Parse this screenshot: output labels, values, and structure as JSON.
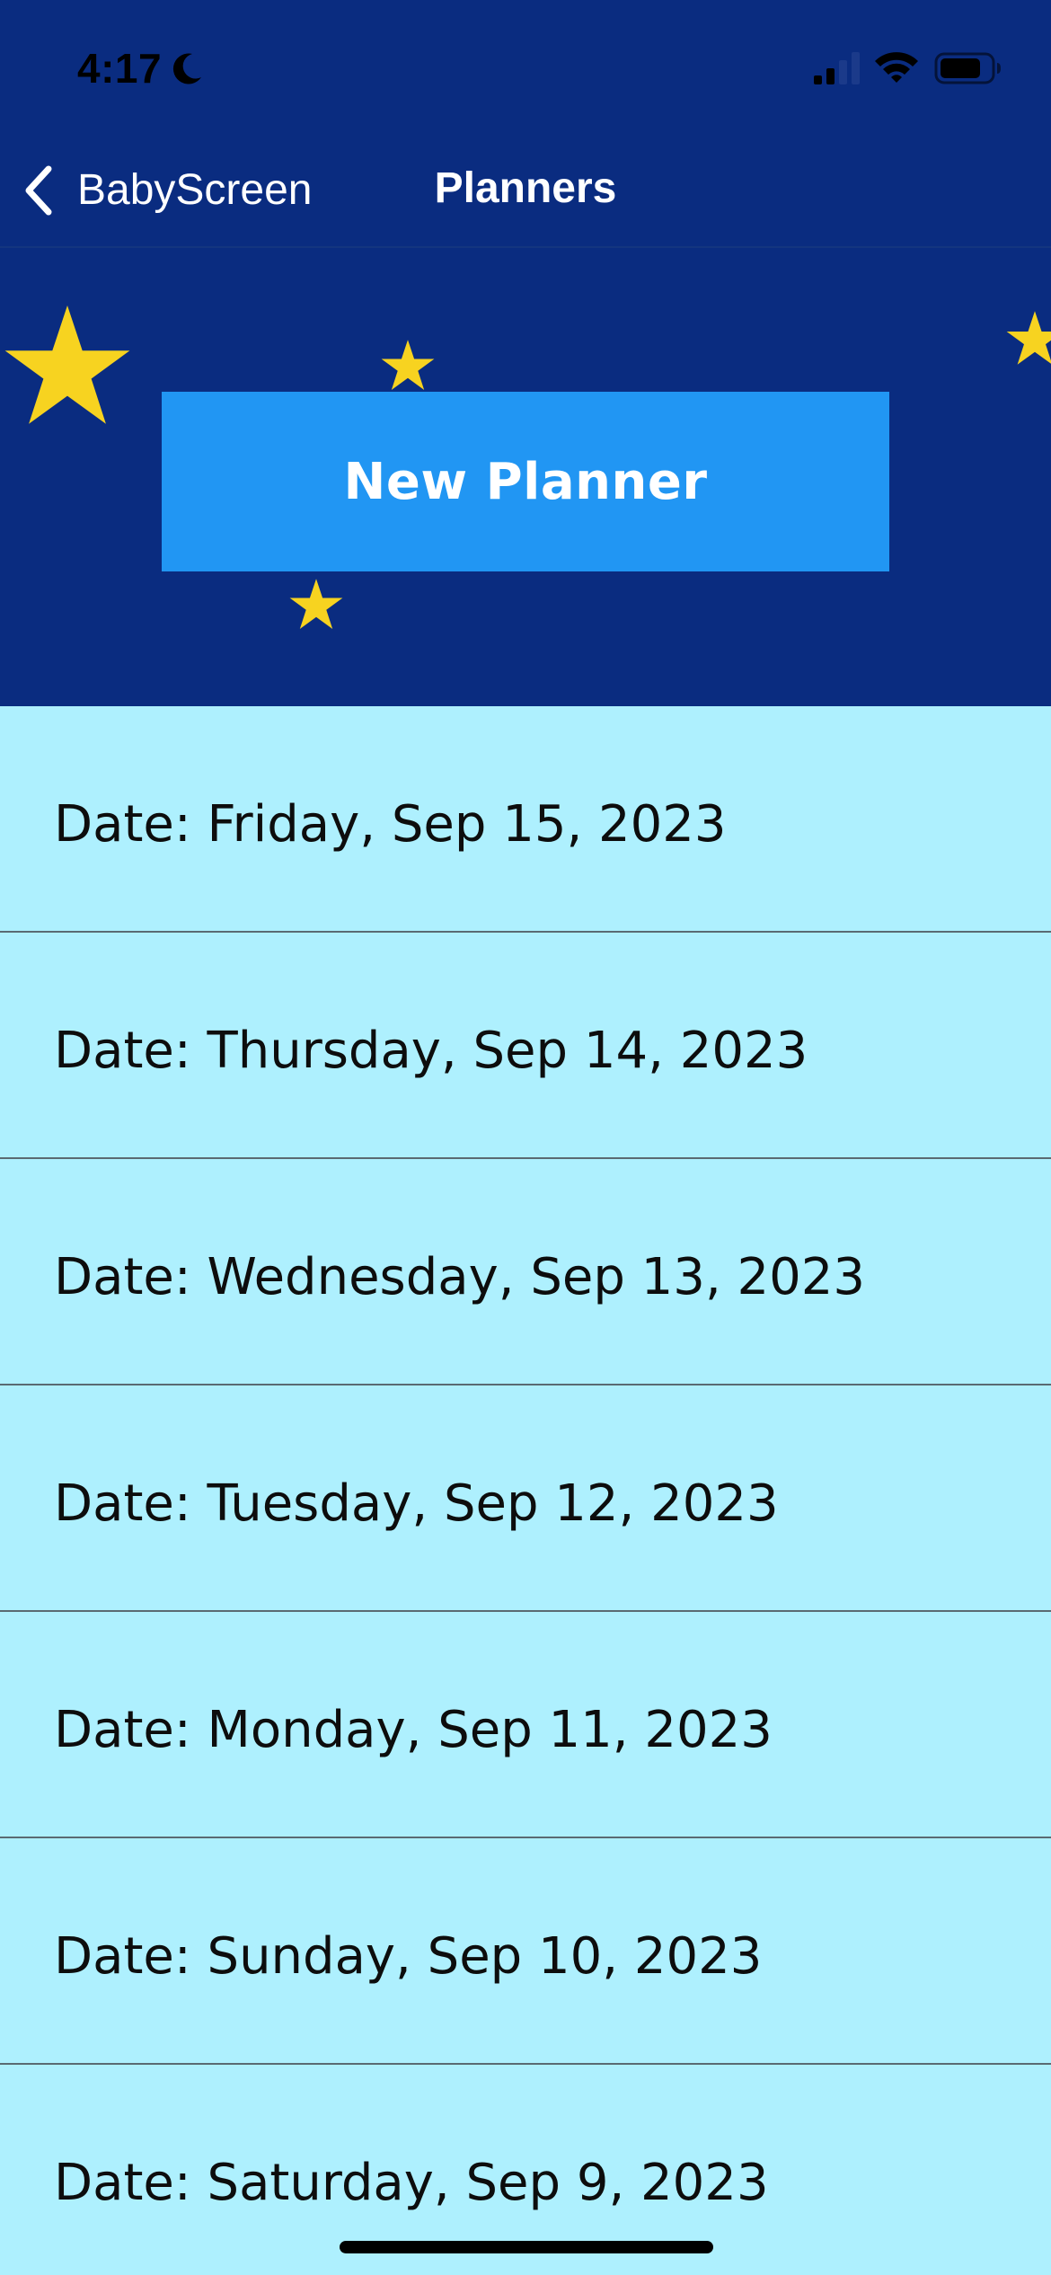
{
  "status_bar": {
    "time": "4:17"
  },
  "nav": {
    "back_label": "BabyScreen",
    "title": "Planners"
  },
  "hero": {
    "new_planner_label": "New Planner"
  },
  "planners": [
    {
      "label": "Date: Friday, Sep 15, 2023"
    },
    {
      "label": "Date: Thursday, Sep 14, 2023"
    },
    {
      "label": "Date: Wednesday, Sep 13, 2023"
    },
    {
      "label": "Date: Tuesday, Sep 12, 2023"
    },
    {
      "label": "Date: Monday, Sep 11, 2023"
    },
    {
      "label": "Date: Sunday, Sep 10, 2023"
    },
    {
      "label": "Date: Saturday, Sep 9, 2023"
    }
  ],
  "colors": {
    "header_background": "#0a2c80",
    "button_background": "#2196f3",
    "list_background": "#aef0fe",
    "star": "#f7d320",
    "divider": "#5a6a72"
  },
  "icons": {
    "back": "chevron-left-icon",
    "moon": "moon-icon",
    "signal": "cellular-signal-icon",
    "wifi": "wifi-icon",
    "battery": "battery-icon",
    "decoration": "star-icon"
  }
}
